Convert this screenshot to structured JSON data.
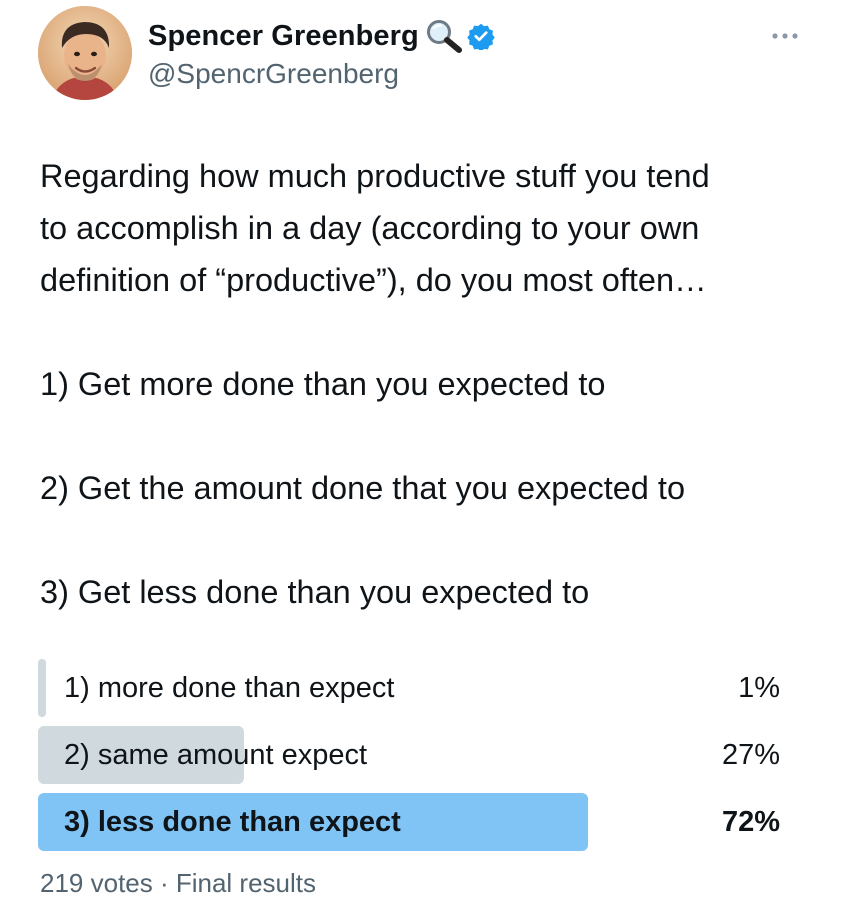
{
  "author": {
    "display_name": "Spencer Greenberg",
    "handle": "@SpencrGreenberg",
    "avatar": "avatar-photo",
    "badges": [
      "magnifier-icon",
      "verified-icon"
    ]
  },
  "menu": {
    "icon": "more-icon"
  },
  "tweet": {
    "intro_lines": [
      "Regarding how much productive stuff you tend",
      "to accomplish in a day (according to your own",
      "definition of “productive”), do you most often…"
    ],
    "options_text": [
      "1) Get more done than you expected to",
      "2) Get the amount done that you expected to",
      "3) Get less done than you expected to"
    ]
  },
  "poll": {
    "options": [
      {
        "label": "1) more done than expect",
        "percent_label": "1%",
        "percent": 1,
        "winner": false
      },
      {
        "label": "2) same amount expect",
        "percent_label": "27%",
        "percent": 27,
        "winner": false
      },
      {
        "label": "3) less done than expect",
        "percent_label": "72%",
        "percent": 72,
        "winner": true
      }
    ],
    "footer": "219 votes · Final results"
  },
  "colors": {
    "text": "#0f1419",
    "secondary": "#536471",
    "bar": "#cfd9de",
    "winner_bar": "#7fc4f5",
    "verified": "#1d9bf0"
  }
}
